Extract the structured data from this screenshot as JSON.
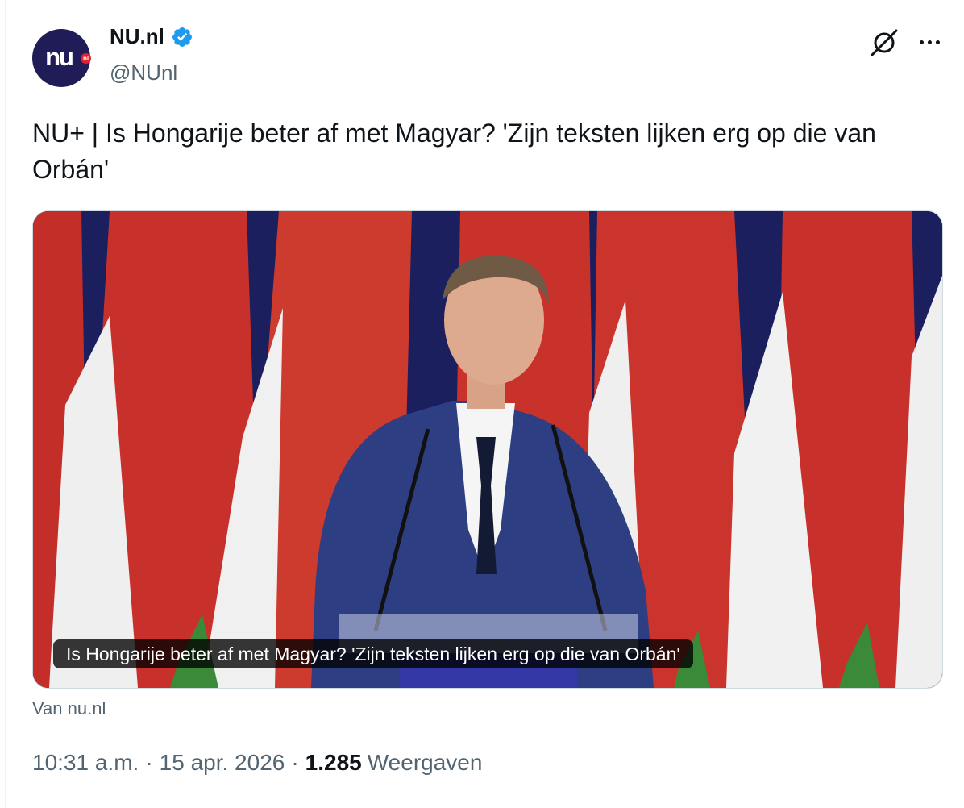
{
  "account": {
    "display_name": "NU.nl",
    "handle": "@NUnl",
    "avatar_text": "nu",
    "avatar_badge": "nl",
    "verified": true,
    "verified_color": "#1d9bf0"
  },
  "header_icons": [
    "grok-icon",
    "more-icon"
  ],
  "tweet": {
    "text": "NU+ | Is Hongarije beter af met Magyar? 'Zijn teksten lijken erg op die van Orbán'"
  },
  "card": {
    "caption": "Is Hongarije beter af met Magyar? 'Zijn teksten lijken erg op die van Orbán'",
    "source": "Van nu.nl"
  },
  "meta": {
    "time": "10:31 a.m.",
    "date": "15 apr. 2026",
    "views_count": "1.285",
    "views_label": "Weergaven"
  },
  "colors": {
    "brand_navy": "#1f1c57",
    "brand_red": "#e5202e",
    "flag_red": "#c8312b",
    "flag_white": "#f2f2f2",
    "flag_green": "#3a8a3a",
    "muted_text": "#536471"
  }
}
